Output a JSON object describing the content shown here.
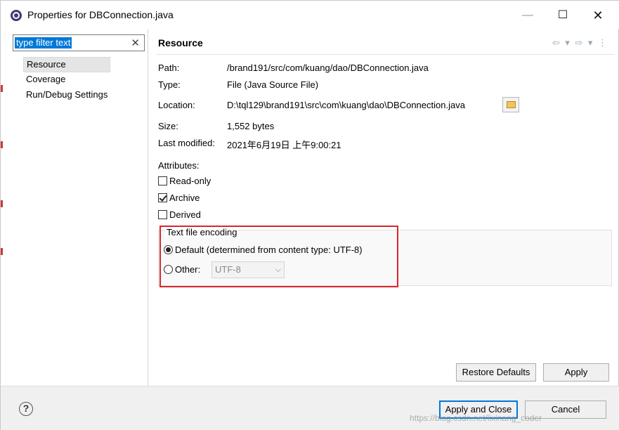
{
  "window": {
    "title": "Properties for DBConnection.java",
    "minimize_glyph": "—",
    "maximize_glyph": "☐",
    "close_glyph": "✕"
  },
  "filter": {
    "value": "type filter text",
    "clear_glyph": "✕"
  },
  "tree": {
    "items": [
      "Resource",
      "Coverage",
      "Run/Debug Settings"
    ],
    "selected": "Resource"
  },
  "page": {
    "title": "Resource",
    "nav": {
      "back_glyph": "⇦ ▾",
      "forward_glyph": "⇨ ▾",
      "menu_glyph": "⋮"
    }
  },
  "props": {
    "path_label": "Path:",
    "path_value": "/brand191/src/com/kuang/dao/DBConnection.java",
    "type_label": "Type:",
    "type_value": "File  (Java Source File)",
    "location_label": "Location:",
    "location_value": "D:\\tql129\\brand191\\src\\com\\kuang\\dao\\DBConnection.java",
    "size_label": "Size:",
    "size_value": "1,552  bytes",
    "modified_label": "Last modified:",
    "modified_value": "2021年6月19日 上午9:00:21"
  },
  "attributes": {
    "label": "Attributes:",
    "items": [
      {
        "label": "Read-only",
        "checked": false
      },
      {
        "label": "Archive",
        "checked": true
      },
      {
        "label": "Derived",
        "checked": false
      }
    ]
  },
  "encoding": {
    "legend": "Text file encoding",
    "default_label": "Default (determined from content type: UTF-8)",
    "other_label": "Other:",
    "other_value": "UTF-8",
    "selected": "default"
  },
  "buttons": {
    "restore": "Restore Defaults",
    "apply": "Apply",
    "apply_close": "Apply and Close",
    "cancel": "Cancel"
  },
  "watermark": "https://blog.csdn.net/lixinang_coder",
  "colors": {
    "highlight": "#d9272e",
    "selection": "#0078d7"
  }
}
